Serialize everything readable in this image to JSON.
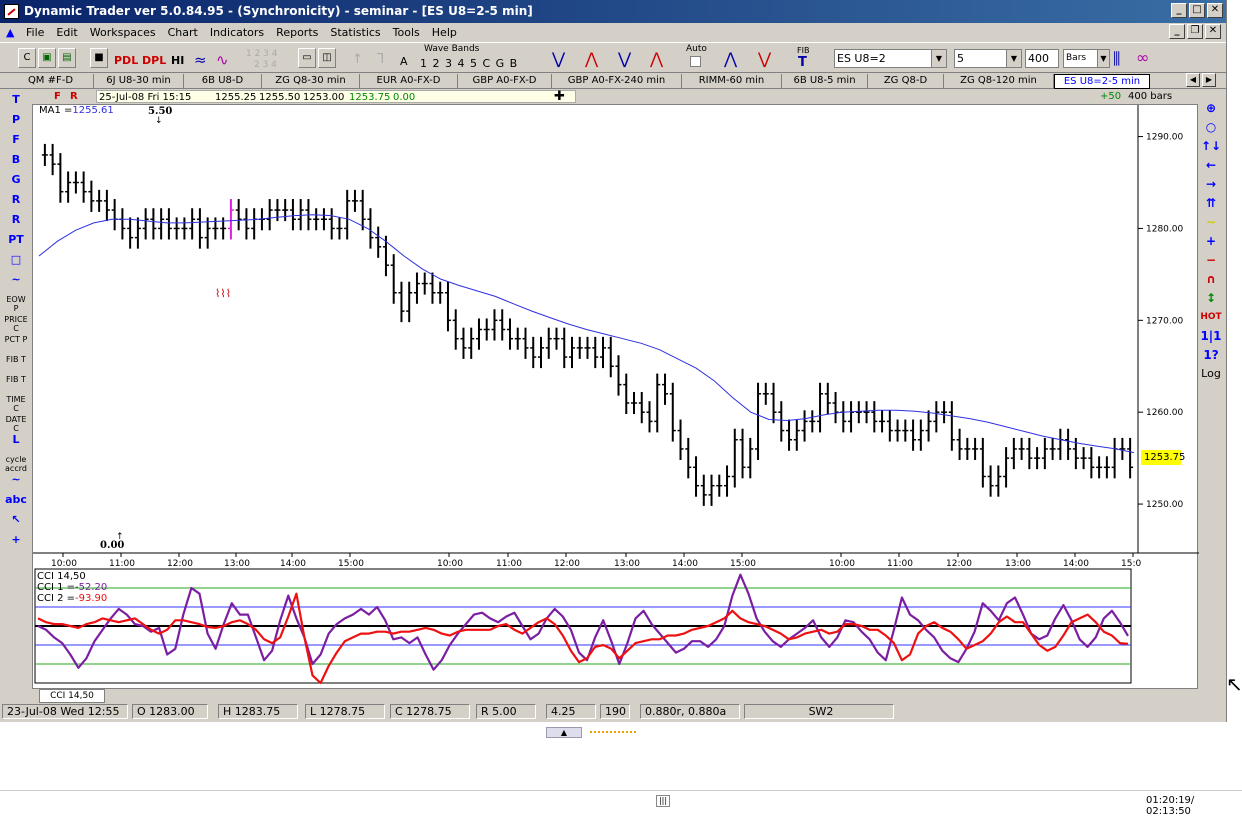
{
  "window": {
    "title": "Dynamic Trader ver 5.0.84.95 - (Synchronicity) - seminar - [ES U8=2-5 min]"
  },
  "menu": [
    "File",
    "Edit",
    "Workspaces",
    "Chart",
    "Indicators",
    "Reports",
    "Statistics",
    "Tools",
    "Help"
  ],
  "toolbar": {
    "buttons": [
      "PDL",
      "DPL",
      "HI"
    ],
    "wave_bands_label": "Wave Bands",
    "wave_digits": "1 2 3 4 5 C G B",
    "letter_a": "A",
    "faded_digits_top": "1 2 3 4",
    "faded_digits_bottom": "2 3 4",
    "auto_label": "Auto",
    "fib_label": "FIB",
    "symbol": "ES U8=2",
    "interval": "5",
    "bars_count": "400",
    "bars_type": "Bars"
  },
  "tabs": [
    "QM #F-D",
    "6J U8-30 min",
    "6B U8-D",
    "ZG Q8-30 min",
    "EUR A0-FX-D",
    "GBP A0-FX-D",
    "GBP A0-FX-240 min",
    "RIMM-60 min",
    "6B U8-5 min",
    "ZG Q8-D",
    "ZG Q8-120 min",
    "ES U8=2-5 min"
  ],
  "quote_bar": {
    "f": "F",
    "r": "R",
    "datetime": "25-Jul-08 Fri 15:15",
    "open": "1255.25",
    "high": "1255.50",
    "low": "1253.00",
    "close": "1253.75",
    "change": "0.00",
    "plus": "+50",
    "bars": "400 bars"
  },
  "left_tools": [
    {
      "name": "trend-tool",
      "label": "T"
    },
    {
      "name": "parallel-tool",
      "label": "P"
    },
    {
      "name": "fan-tool",
      "label": "F"
    },
    {
      "name": "b-tool",
      "label": "B"
    },
    {
      "name": "g-tool",
      "label": "G"
    },
    {
      "name": "r-tool",
      "label": "R"
    },
    {
      "name": "r2-tool",
      "label": "R"
    },
    {
      "name": "pt-tool",
      "label": "PT"
    },
    {
      "name": "rect-tool",
      "label": "□"
    },
    {
      "name": "zigzag-tool",
      "label": "~"
    },
    {
      "name": "eow-tool",
      "label": "EOW P"
    },
    {
      "name": "price-tool",
      "label": "PRICE C"
    },
    {
      "name": "pct-tool",
      "label": "PCT P"
    },
    {
      "name": "fib-t-tool",
      "label": "FIB T"
    },
    {
      "name": "fib-t2-tool",
      "label": "FIB T"
    },
    {
      "name": "time-tool",
      "label": "TIME C"
    },
    {
      "name": "date-tool",
      "label": "DATE C"
    },
    {
      "name": "l-tool",
      "label": "L"
    },
    {
      "name": "cycle-tool",
      "label": "cycle accrd"
    },
    {
      "name": "wave-tool",
      "label": "~"
    },
    {
      "name": "abc-tool",
      "label": "abc"
    },
    {
      "name": "select-tool",
      "label": "↖"
    },
    {
      "name": "cross-tool",
      "label": "+"
    }
  ],
  "right_tools": [
    {
      "name": "zoom-in",
      "label": "⊕"
    },
    {
      "name": "zoom-out",
      "label": "○"
    },
    {
      "name": "up-arrows",
      "label": "↑↓"
    },
    {
      "name": "left-arrow",
      "label": "←"
    },
    {
      "name": "right-arrow",
      "label": "→"
    },
    {
      "name": "compress",
      "label": "⇈"
    },
    {
      "name": "wave",
      "label": "∼"
    },
    {
      "name": "plus",
      "label": "+"
    },
    {
      "name": "minus",
      "label": "−"
    },
    {
      "name": "magnet",
      "label": "∩"
    },
    {
      "name": "updown",
      "label": "↕"
    },
    {
      "name": "hot",
      "label": "HOT"
    },
    {
      "name": "one-one",
      "label": "1|1"
    },
    {
      "name": "one-q",
      "label": "1?"
    },
    {
      "name": "log",
      "label": "Log"
    }
  ],
  "chart_data": {
    "type": "bar",
    "ma_label": "MA1 =",
    "ma_value": "1255.61",
    "top_annotation": "5.50",
    "bottom_annotation": "0.00",
    "current_price": "1253.75",
    "y_ticks": [
      "1290.00",
      "1280.00",
      "1270.00",
      "1260.00",
      "1250.00"
    ],
    "ylim": [
      1245,
      1293
    ],
    "x_ticks": [
      "10:00",
      "11:00",
      "12:00",
      "13:00",
      "14:00",
      "15:00",
      "10:00",
      "11:00",
      "12:00",
      "13:00",
      "14:00",
      "15:00",
      "10:00",
      "11:00",
      "12:00",
      "13:00",
      "14:00",
      "15:0"
    ],
    "closes": [
      1288,
      1287,
      1284,
      1285,
      1285,
      1284,
      1283,
      1283,
      1282,
      1281,
      1280,
      1279,
      1280,
      1281,
      1280,
      1281,
      1280,
      1280,
      1280,
      1281,
      1279,
      1280,
      1280,
      1280,
      1282,
      1281,
      1280,
      1281,
      1281,
      1282,
      1282,
      1282,
      1281,
      1282,
      1281,
      1281,
      1281,
      1280,
      1280,
      1283,
      1283,
      1281,
      1279,
      1278,
      1276,
      1273,
      1271,
      1273,
      1274,
      1274,
      1273,
      1273,
      1270,
      1268,
      1267,
      1268,
      1269,
      1269,
      1270,
      1269,
      1268,
      1268,
      1267,
      1266,
      1267,
      1268,
      1268,
      1266,
      1267,
      1267,
      1267,
      1266,
      1267,
      1265,
      1263,
      1261,
      1261,
      1260,
      1259,
      1263,
      1262,
      1258,
      1256,
      1254,
      1252,
      1251,
      1252,
      1252,
      1253,
      1257,
      1254,
      1256,
      1262,
      1262,
      1260,
      1258,
      1257,
      1258,
      1259,
      1259,
      1262,
      1261,
      1260,
      1259,
      1260,
      1260,
      1260,
      1259,
      1259,
      1258,
      1258,
      1258,
      1257,
      1258,
      1259,
      1260,
      1260,
      1257,
      1256,
      1256,
      1256,
      1253,
      1252,
      1253,
      1255,
      1256,
      1256,
      1255,
      1255,
      1256,
      1256,
      1257,
      1256,
      1255,
      1255,
      1254,
      1254,
      1254,
      1256,
      1256,
      1254
    ],
    "ma": [
      1277,
      1278.6,
      1279.8,
      1280.6,
      1281,
      1281,
      1280.8,
      1280.6,
      1280.6,
      1280.7,
      1280.8,
      1280.9,
      1281,
      1281.2,
      1281.4,
      1281.5,
      1281.4,
      1281,
      1280,
      1278.6,
      1277,
      1275.6,
      1274.5,
      1273.8,
      1273.2,
      1272.6,
      1271.8,
      1271,
      1270.3,
      1269.6,
      1269,
      1268.5,
      1268,
      1267.5,
      1266.8,
      1265.8,
      1264.8,
      1263.4,
      1261.6,
      1260,
      1259.2,
      1259.1,
      1259.3,
      1259.7,
      1260,
      1260.1,
      1260.2,
      1260.2,
      1260.1,
      1259.9,
      1259.6,
      1259.3,
      1258.9,
      1258.4,
      1257.9,
      1257.4,
      1257,
      1256.6,
      1256.3,
      1256,
      1255.6
    ],
    "cci": {
      "label": "CCI 14,50",
      "cci1_label": "CCI 1  =",
      "cci1_value": "-52.20",
      "cci2_label": "CCI 2  =",
      "cci2_value": "-93.90",
      "ylim": [
        -300,
        300
      ],
      "levels": [
        200,
        100,
        0,
        -100,
        -200
      ],
      "cci1_color": "#7b1fa2",
      "cci2_color": "#ee1111",
      "cci1": [
        0,
        -20,
        -60,
        -90,
        -150,
        -220,
        -170,
        -80,
        -20,
        40,
        90,
        60,
        10,
        0,
        -30,
        -10,
        -150,
        -120,
        60,
        200,
        170,
        -40,
        -120,
        10,
        120,
        60,
        60,
        -60,
        -180,
        -130,
        30,
        160,
        40,
        -60,
        -200,
        -150,
        -40,
        10,
        40,
        60,
        90,
        60,
        100,
        30,
        -70,
        -60,
        -90,
        -60,
        -150,
        -230,
        -180,
        -100,
        -40,
        10,
        60,
        70,
        40,
        20,
        50,
        70,
        0,
        -70,
        -40,
        40,
        90,
        50,
        -20,
        -140,
        -180,
        -60,
        30,
        -80,
        -200,
        -90,
        40,
        80,
        10,
        -40,
        -90,
        -140,
        -120,
        -80,
        -80,
        -110,
        -70,
        0,
        160,
        270,
        170,
        40,
        -30,
        -80,
        -110,
        -70,
        -40,
        -10,
        30,
        -60,
        -110,
        -60,
        30,
        20,
        -30,
        -70,
        -140,
        -180,
        -20,
        150,
        60,
        30,
        -20,
        -60,
        -130,
        -170,
        -190,
        -120,
        -30,
        120,
        80,
        30,
        120,
        150,
        60,
        -40,
        -70,
        -50,
        40,
        110,
        30,
        -70,
        -110,
        -60,
        40,
        80,
        20,
        -52
      ],
      "cci2": [
        40,
        20,
        10,
        10,
        0,
        -10,
        10,
        20,
        40,
        30,
        20,
        30,
        40,
        10,
        -20,
        -40,
        -20,
        30,
        30,
        20,
        10,
        -5,
        -10,
        0,
        20,
        30,
        10,
        -20,
        -70,
        -90,
        -60,
        50,
        170,
        -60,
        -260,
        -300,
        -210,
        -140,
        -80,
        -60,
        -40,
        -40,
        -30,
        -30,
        -40,
        -30,
        -30,
        -20,
        -10,
        -20,
        -40,
        -50,
        -30,
        -20,
        -20,
        -20,
        -20,
        0,
        10,
        -20,
        -40,
        -10,
        20,
        40,
        10,
        -50,
        -130,
        -190,
        -170,
        -110,
        -100,
        -120,
        -170,
        -130,
        -90,
        -80,
        -70,
        -70,
        -50,
        -50,
        -40,
        -20,
        -10,
        0,
        20,
        40,
        80,
        40,
        20,
        10,
        0,
        -20,
        -40,
        -70,
        -60,
        -40,
        -30,
        -20,
        -40,
        -30,
        10,
        10,
        0,
        -20,
        -20,
        -50,
        -90,
        -180,
        -150,
        -40,
        0,
        20,
        -10,
        -30,
        -70,
        -120,
        -100,
        -80,
        -40,
        20,
        50,
        20,
        20,
        -40,
        -100,
        -130,
        -110,
        -50,
        20,
        40,
        60,
        20,
        -30,
        -50,
        -90,
        -94
      ]
    }
  },
  "bottom_tab": "CCI 14,50",
  "status": {
    "date": "23-Jul-08 Wed 12:55",
    "open": "O 1283.00",
    "high": "H 1283.75",
    "low": "L 1278.75",
    "close": "C 1278.75",
    "range": "R 5.00",
    "v1": "4.25",
    "v2": "190",
    "ratio": "0.880r, 0.880a",
    "sw": "SW2"
  },
  "player": {
    "time": "01:20:19/ 02:13:50"
  },
  "colors": {
    "ma": "#3030e0",
    "bars": "#000000",
    "highlight_bar": "#e020e0",
    "price_tag": "#ffff00"
  }
}
